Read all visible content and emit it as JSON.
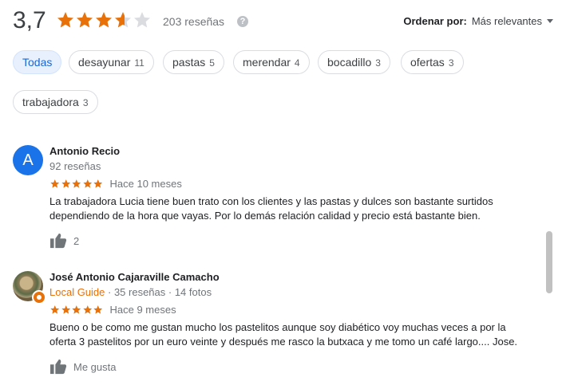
{
  "header": {
    "rating": "3,7",
    "stars_value": 3.7,
    "review_count": "203 reseñas",
    "help_icon": "?",
    "sort_label": "Ordenar por:",
    "sort_value": "Más relevantes"
  },
  "chips": [
    {
      "label": "Todas",
      "count": ""
    },
    {
      "label": "desayunar",
      "count": "11"
    },
    {
      "label": "pastas",
      "count": "5"
    },
    {
      "label": "merendar",
      "count": "4"
    },
    {
      "label": "bocadillo",
      "count": "3"
    },
    {
      "label": "ofertas",
      "count": "3"
    },
    {
      "label": "trabajadora",
      "count": "3"
    }
  ],
  "reviews": [
    {
      "avatar_letter": "A",
      "name": "Antonio Recio",
      "meta": "92 reseñas",
      "stars": 5,
      "time": "Hace 10 meses",
      "text_line1": "La trabajadora Lucia tiene buen trato con los clientes y las pastas y dulces son bastante surtidos",
      "text_line2": "dependiendo de la hora que vayas. Por lo demás relación calidad y precio está bastante bien.",
      "likes": "2"
    },
    {
      "name": "José Antonio Cajaraville Camacho",
      "guide_label": "Local Guide",
      "meta": " · 35 reseñas · 14 fotos",
      "stars": 5,
      "time": "Hace 9 meses",
      "text_line1": "Bueno o be como me gustan mucho los pastelitos aunque soy diabético voy muchas veces a por la",
      "text_line2": "oferta 3 pastelitos por un euro veinte y después me rasco la butxaca y me tomo un café largo.... Jose.",
      "likes": "Me gusta"
    }
  ],
  "colors": {
    "star": "#e8710a",
    "star_empty": "#dadce0",
    "active_chip_bg": "#e8f0fe",
    "active_chip_text": "#1967d2",
    "avatar_blue": "#1a73e8"
  }
}
